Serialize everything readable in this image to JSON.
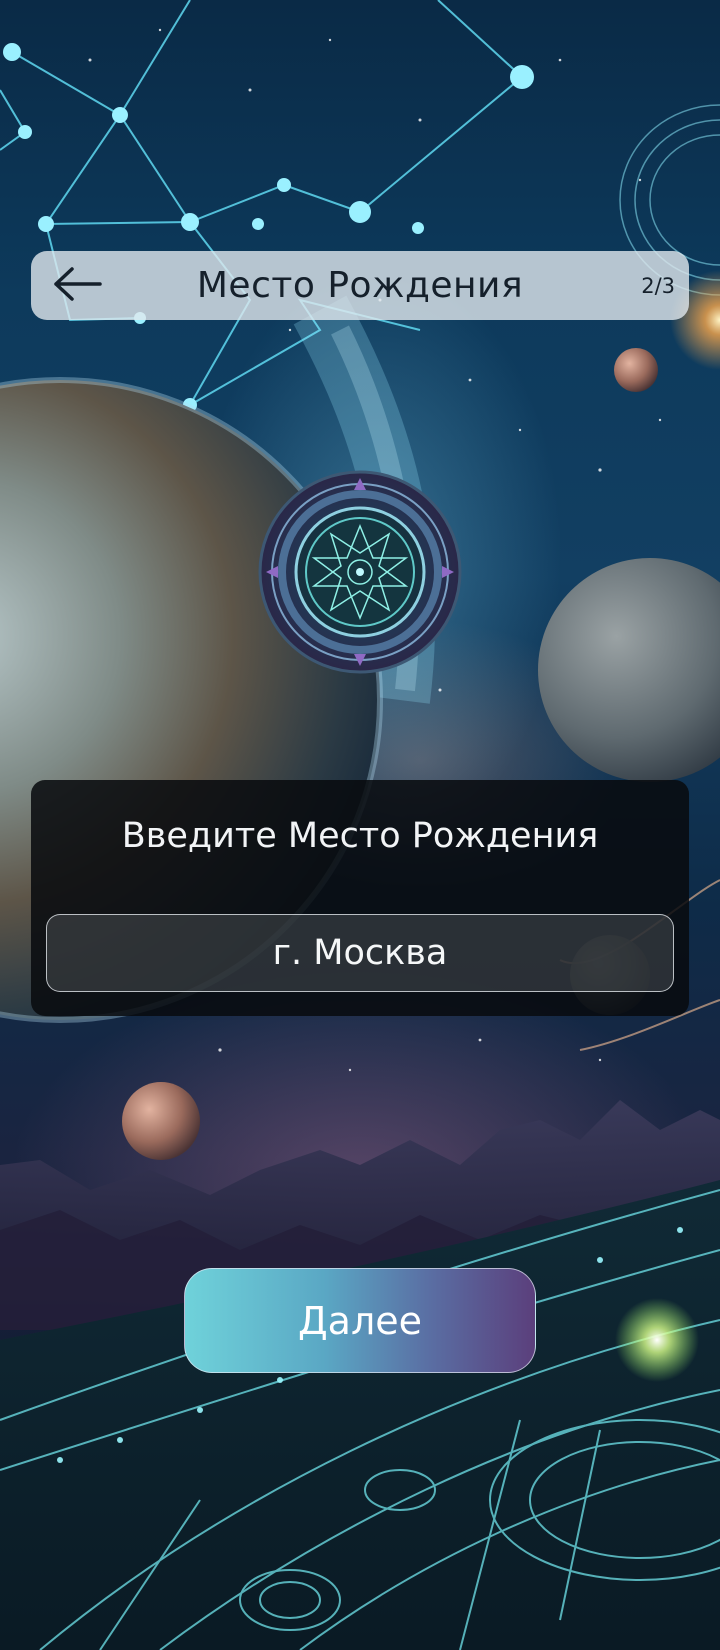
{
  "header": {
    "back_icon": "arrow-left-icon",
    "title": "Место Рождения",
    "step": "2/3"
  },
  "emblem": {
    "icon": "zodiac-emblem-icon"
  },
  "form": {
    "title": "Введите Место Рождения",
    "place_value": "г. Москва"
  },
  "actions": {
    "next_label": "Далее"
  },
  "colors": {
    "header_bg": "#e1e8ee",
    "card_bg": "#080a0e",
    "button_gradient_start": "#6fd2da",
    "button_gradient_end": "#5b3f7c",
    "text_dark": "#15202b",
    "text_light": "#f2f4f6"
  }
}
